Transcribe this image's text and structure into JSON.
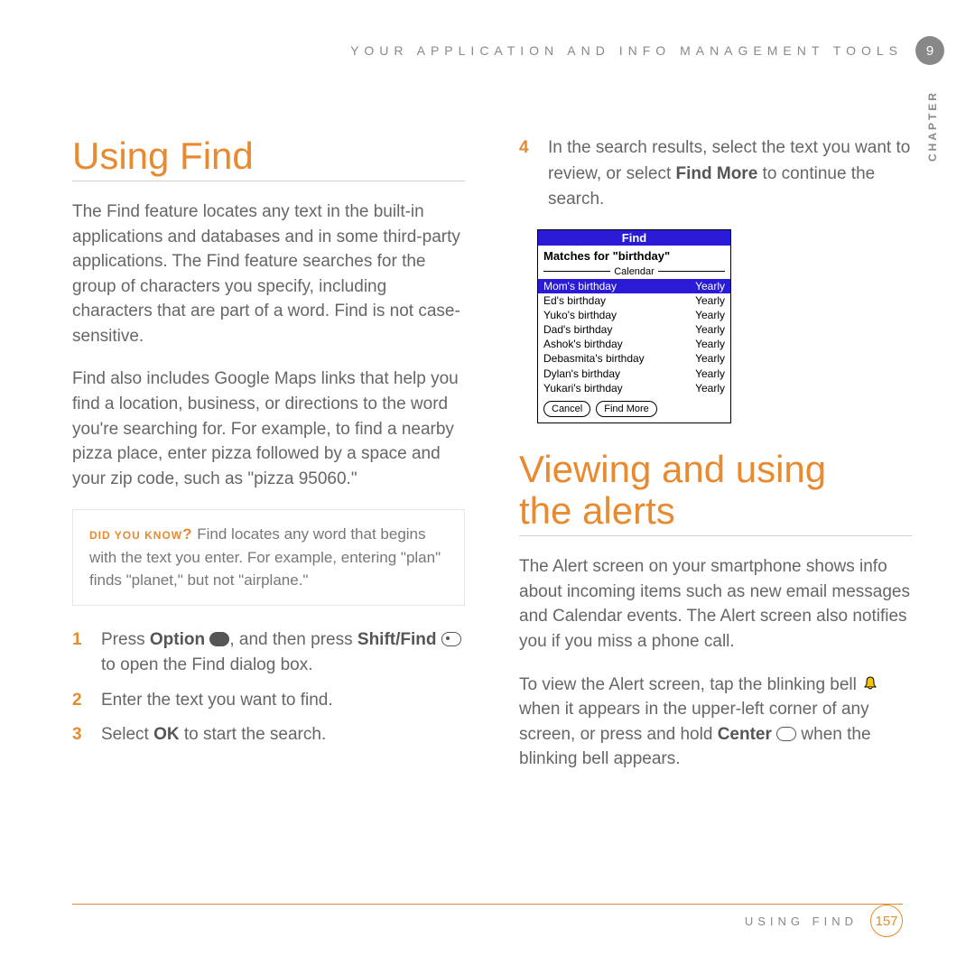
{
  "header": "YOUR APPLICATION AND INFO MANAGEMENT TOOLS",
  "chapter_num": "9",
  "chapter_label": "CHAPTER",
  "left": {
    "heading": "Using Find",
    "para1": "The Find feature locates any text in the built-in applications and databases and in some third-party applications. The Find feature searches for the group of characters you specify, including characters that are part of a word. Find is not case-sensitive.",
    "para2": "Find also includes Google Maps links that help you find a location, business, or directions to the word you're searching for. For example, to find a nearby pizza place, enter pizza followed by a space and your zip code, such as \"pizza 95060.\"",
    "tip_label": "DID YOU KNOW",
    "tip_text": "Find locates any word that begins with the text you enter. For example, entering \"plan\" finds \"planet,\" but not \"airplane.\"",
    "step1_a": "Press ",
    "step1_b": "Option",
    "step1_c": " ",
    "step1_d": ", and then press ",
    "step1_e": "Shift/Find",
    "step1_f": " ",
    "step1_g": " to open the Find dialog box.",
    "step2": "Enter the text you want to find.",
    "step3_a": "Select ",
    "step3_b": "OK",
    "step3_c": " to start the search."
  },
  "right": {
    "step4_a": "In the search results, select the text you want to review, or select ",
    "step4_b": "Find More",
    "step4_c": " to continue the search.",
    "heading2": "Viewing and using\nthe alerts",
    "para1": "The Alert screen on your smartphone shows info about incoming items such as new email messages and Calendar events. The Alert screen also notifies you if you miss a phone call.",
    "para2_a": "To view the Alert screen, tap the blinking bell ",
    "para2_b": " when it appears in the upper-left corner of any screen, or press and hold ",
    "para2_c": "Center",
    "para2_d": " ",
    "para2_e": " when the blinking bell appears."
  },
  "find_dialog": {
    "title": "Find",
    "matches": "Matches for \"birthday\"",
    "group": "Calendar",
    "rows": [
      {
        "name": "Mom's birthday",
        "freq": "Yearly",
        "selected": true
      },
      {
        "name": "Ed's birthday",
        "freq": "Yearly",
        "selected": false
      },
      {
        "name": "Yuko's birthday",
        "freq": "Yearly",
        "selected": false
      },
      {
        "name": "Dad's birthday",
        "freq": "Yearly",
        "selected": false
      },
      {
        "name": "Ashok's birthday",
        "freq": "Yearly",
        "selected": false
      },
      {
        "name": "Debasmita's birthday",
        "freq": "Yearly",
        "selected": false
      },
      {
        "name": "Dylan's birthday",
        "freq": "Yearly",
        "selected": false
      },
      {
        "name": "Yukari's birthday",
        "freq": "Yearly",
        "selected": false
      }
    ],
    "btn_cancel": "Cancel",
    "btn_more": "Find More"
  },
  "footer": {
    "label": "USING FIND",
    "page": "157"
  }
}
